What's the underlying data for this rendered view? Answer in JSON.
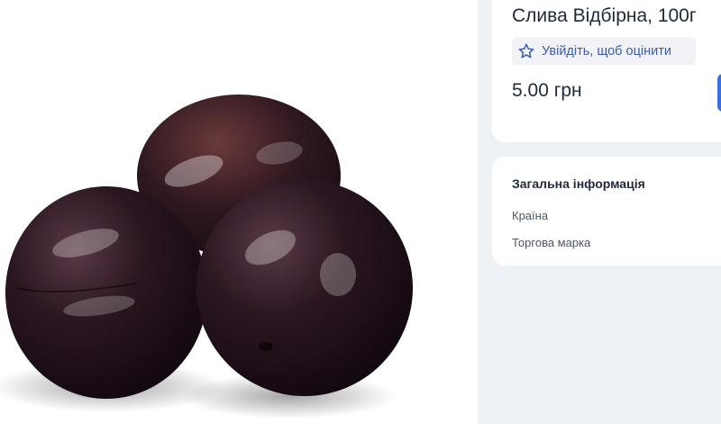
{
  "product": {
    "title": "Слива Відбірна, 100г",
    "image_alt": "plums-photo",
    "price": "5.00 грн",
    "rate_label": "Увійдіть, щоб оцінити",
    "rate_icon": "star-outline-icon"
  },
  "info": {
    "heading": "Загальна інформація",
    "rows": [
      "Країна",
      "Торгова марка"
    ]
  },
  "colors": {
    "accent": "#3d6ee0",
    "link": "#3d5ba9",
    "background": "#eef1f6"
  }
}
